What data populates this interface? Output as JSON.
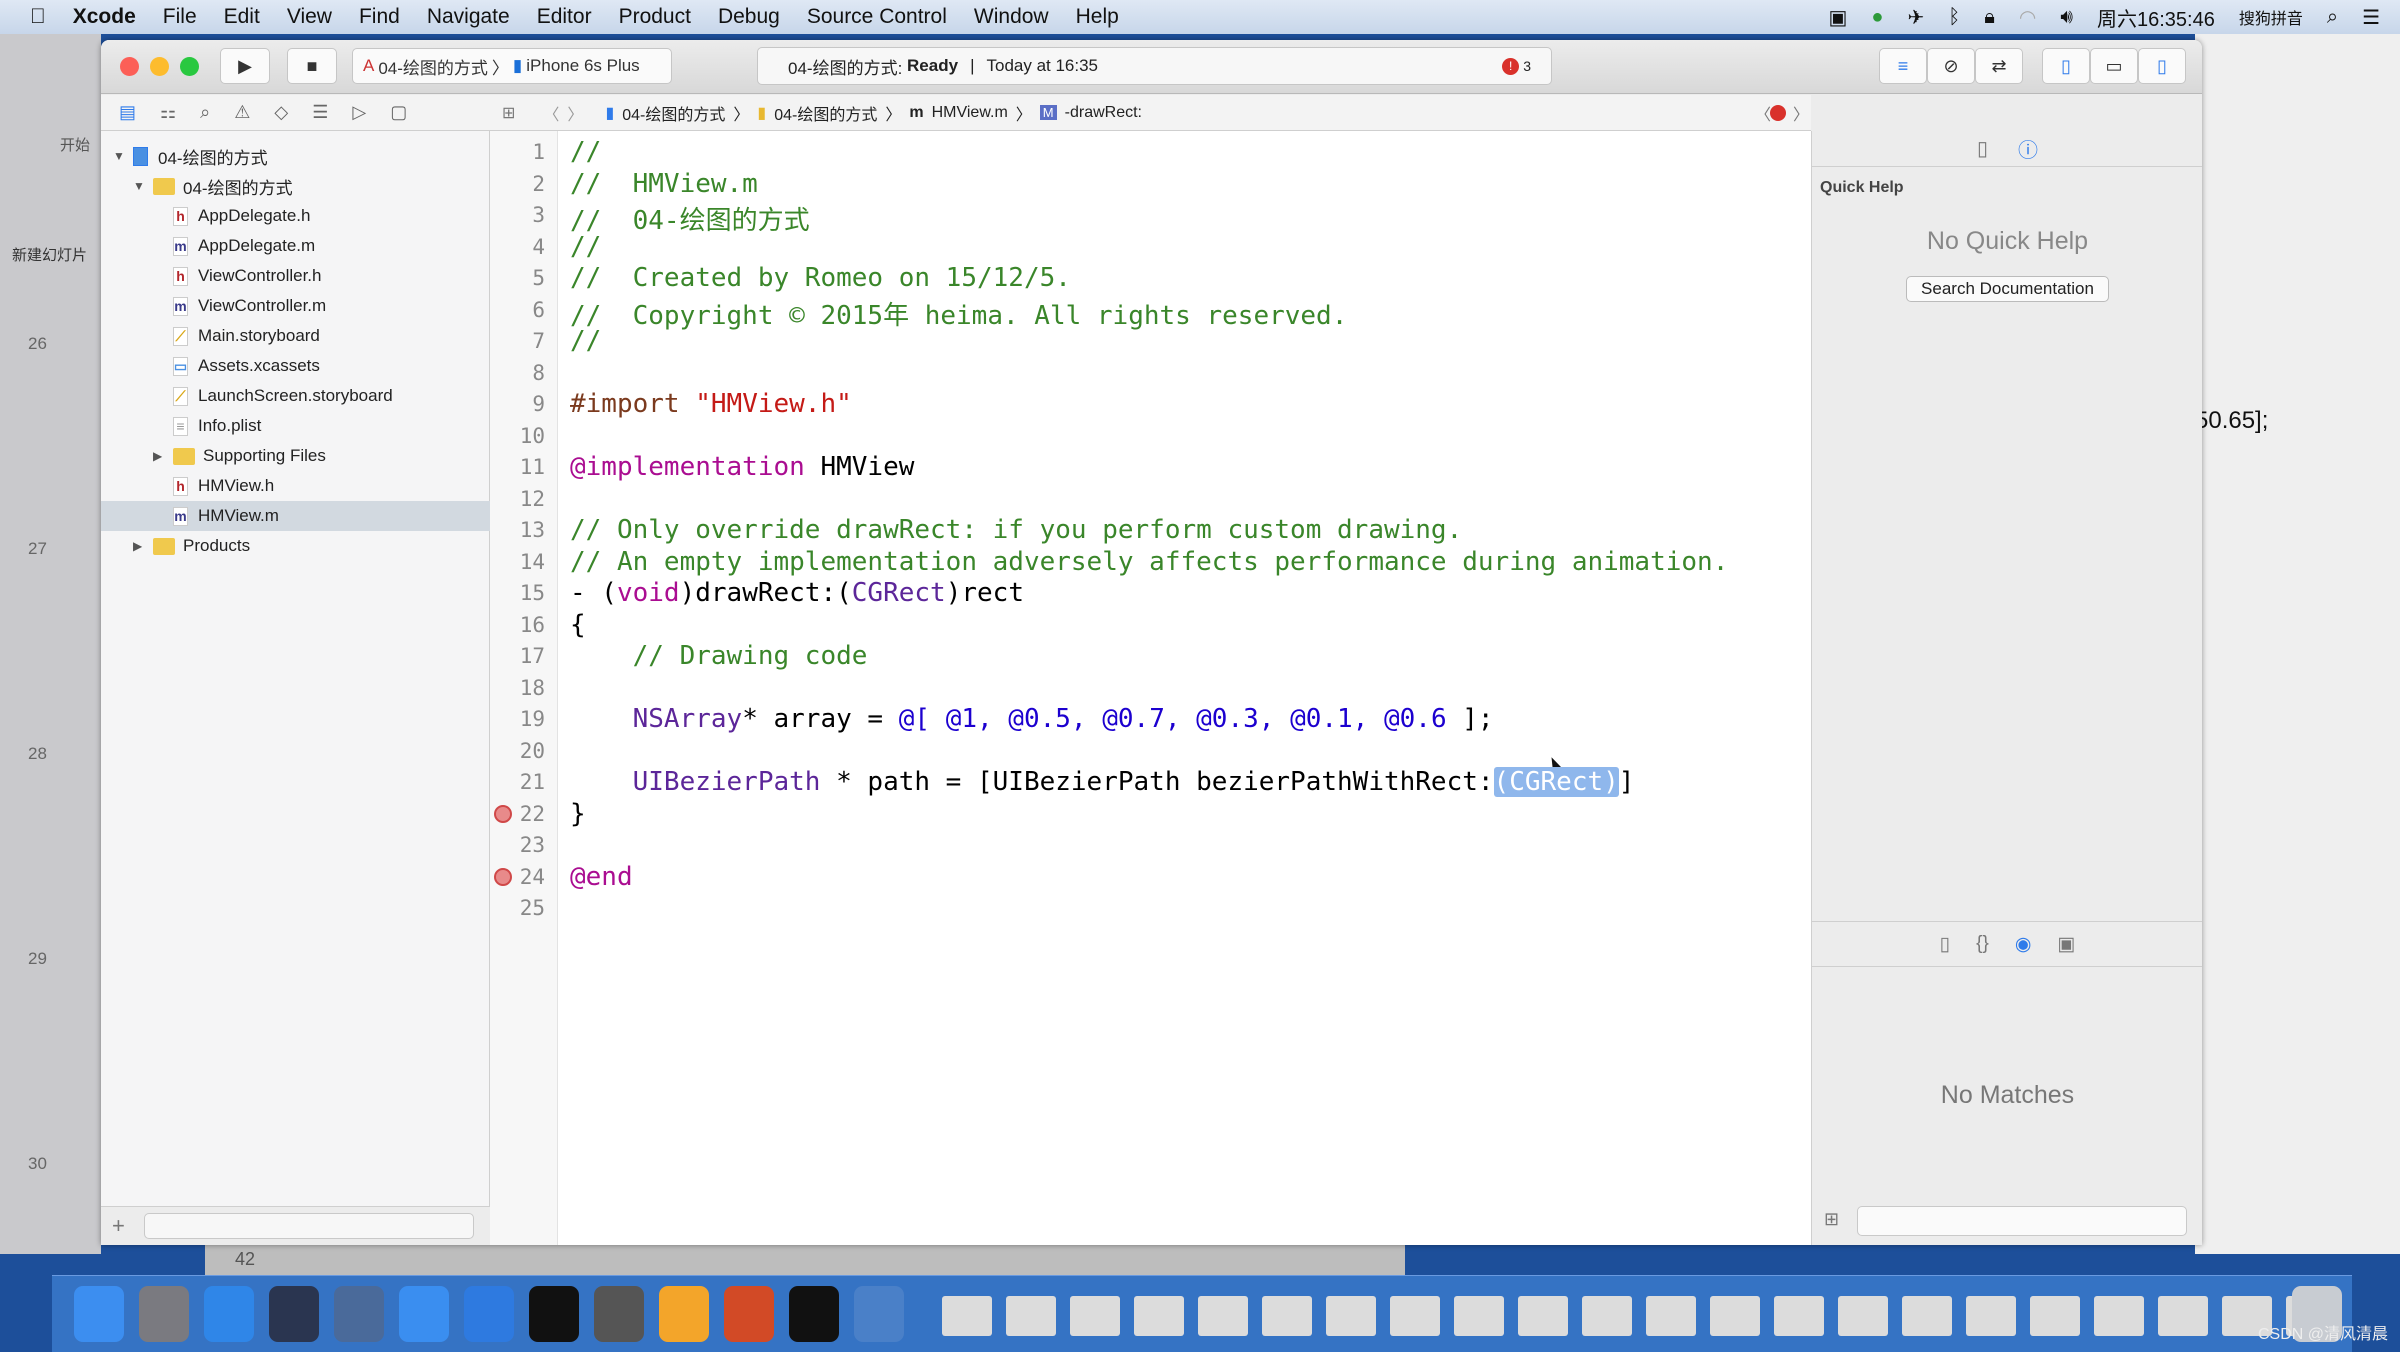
{
  "menubar": {
    "app": "Xcode",
    "items": [
      "File",
      "Edit",
      "View",
      "Find",
      "Navigate",
      "Editor",
      "Product",
      "Debug",
      "Source Control",
      "Window",
      "Help"
    ],
    "clock": "周六16:35:46",
    "ime": "搜狗拼音"
  },
  "toolbar": {
    "scheme": "04-绘图的方式",
    "device": "iPhone 6s Plus",
    "status_project": "04-绘图的方式:",
    "status_state": "Ready",
    "status_time": "Today at 16:35",
    "error_count": "3"
  },
  "jumpbar": {
    "crumbs": [
      "04-绘图的方式",
      "04-绘图的方式",
      "HMView.m",
      "-drawRect:"
    ]
  },
  "navigator": {
    "items": [
      {
        "label": "04-绘图的方式",
        "kind": "project",
        "level": 0,
        "open": true
      },
      {
        "label": "04-绘图的方式",
        "kind": "folder",
        "level": 1,
        "open": true
      },
      {
        "label": "AppDelegate.h",
        "kind": "h",
        "level": 2
      },
      {
        "label": "AppDelegate.m",
        "kind": "m",
        "level": 2
      },
      {
        "label": "ViewController.h",
        "kind": "h",
        "level": 2
      },
      {
        "label": "ViewController.m",
        "kind": "m",
        "level": 2
      },
      {
        "label": "Main.storyboard",
        "kind": "sb",
        "level": 2
      },
      {
        "label": "Assets.xcassets",
        "kind": "assets",
        "level": 2
      },
      {
        "label": "LaunchScreen.storyboard",
        "kind": "sb",
        "level": 2
      },
      {
        "label": "Info.plist",
        "kind": "plist",
        "level": 2
      },
      {
        "label": "Supporting Files",
        "kind": "folder",
        "level": 2,
        "open": false
      },
      {
        "label": "HMView.h",
        "kind": "h",
        "level": 2
      },
      {
        "label": "HMView.m",
        "kind": "m",
        "level": 2,
        "selected": true
      },
      {
        "label": "Products",
        "kind": "folder",
        "level": 1,
        "open": false
      }
    ]
  },
  "editor": {
    "error_lines": [
      22,
      24
    ],
    "lines": [
      [
        [
          "cm",
          "//"
        ]
      ],
      [
        [
          "cm",
          "//  HMView.m"
        ]
      ],
      [
        [
          "cm",
          "//  04-绘图的方式"
        ]
      ],
      [
        [
          "cm",
          "//"
        ]
      ],
      [
        [
          "cm",
          "//  Created by Romeo on 15/12/5."
        ]
      ],
      [
        [
          "cm",
          "//  Copyright © 2015年 heima. All rights reserved."
        ]
      ],
      [
        [
          "cm",
          "//"
        ]
      ],
      [],
      [
        [
          "pp",
          "#import "
        ],
        [
          "str",
          "\"HMView.h\""
        ]
      ],
      [],
      [
        [
          "kw",
          "@implementation"
        ],
        [
          "pl",
          " HMView"
        ]
      ],
      [],
      [
        [
          "cm",
          "// Only override drawRect: if you perform custom drawing."
        ]
      ],
      [
        [
          "cm",
          "// An empty implementation adversely affects performance during animation."
        ]
      ],
      [
        [
          "pl",
          "- ("
        ],
        [
          "kw",
          "void"
        ],
        [
          "pl",
          ")drawRect:("
        ],
        [
          "ty",
          "CGRect"
        ],
        [
          "pl",
          ")rect"
        ]
      ],
      [
        [
          "pl",
          "{"
        ]
      ],
      [
        [
          "cm",
          "    // Drawing code"
        ]
      ],
      [],
      [
        [
          "ty",
          "    NSArray"
        ],
        [
          "pl",
          "* array = "
        ],
        [
          "num",
          "@[ @1, @0.5, @0.7, @0.3, @0.1, @0.6"
        ],
        [
          "pl",
          " ];"
        ]
      ],
      [],
      [
        [
          "ty",
          "    UIBezierPath"
        ],
        [
          "pl",
          " * path = [UIBezierPath bezierPathWithRect:"
        ],
        [
          "ph",
          "(CGRect)"
        ],
        [
          "pl",
          "]"
        ]
      ],
      [
        [
          "pl",
          "}"
        ]
      ],
      [],
      [
        [
          "kw",
          "@end"
        ]
      ],
      []
    ]
  },
  "inspector": {
    "title": "Quick Help",
    "empty": "No Quick Help",
    "search_button": "Search Documentation",
    "library_empty": "No Matches"
  },
  "background": {
    "ppt_tab": "开始",
    "ppt_new_slide": "新建幻灯片",
    "slide_numbers": [
      "26",
      "27",
      "28",
      "29",
      "30"
    ],
    "ppt_page": "42",
    "right_text": "50.65];"
  },
  "dock": {
    "apps": [
      "finder",
      "launchpad",
      "safari",
      "mouse",
      "imovie",
      "xcode",
      "xcode-alt",
      "terminal",
      "system-preferences",
      "sketch",
      "powerpoint",
      "activity-monitor",
      "photo-app"
    ],
    "minimized_count": 22
  },
  "watermark": "CSDN @清风清晨",
  "colors": {
    "accent": "#2f7bea",
    "error": "#d9312b",
    "selection": "#8fb7ec"
  }
}
